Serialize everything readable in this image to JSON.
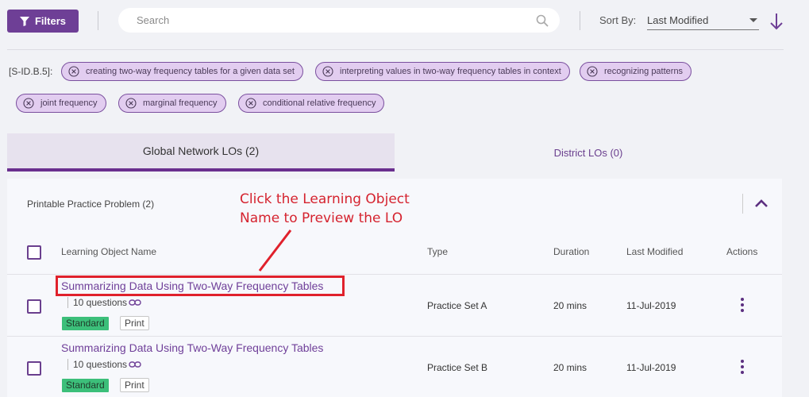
{
  "toolbar": {
    "filters_label": "Filters",
    "search_placeholder": "Search",
    "sort_label": "Sort By:",
    "sort_value": "Last Modified"
  },
  "standard": {
    "code": "[S-ID.B.5]:",
    "chips": [
      "creating two-way frequency tables for a given data set",
      "interpreting values in two-way frequency tables in context",
      "recognizing patterns",
      "joint frequency",
      "marginal frequency",
      "conditional relative frequency"
    ]
  },
  "tabs": {
    "global": "Global Network LOs (2)",
    "district": "District LOs (0)"
  },
  "section": {
    "title": "Printable Practice Problem (2)"
  },
  "table": {
    "headers": {
      "name": "Learning Object Name",
      "type": "Type",
      "duration": "Duration",
      "modified": "Last Modified",
      "actions": "Actions"
    },
    "rows": [
      {
        "name": "Summarizing Data Using Two-Way Frequency Tables",
        "questions": "10 questions",
        "badge": "Standard",
        "print": "Print",
        "type": "Practice Set A",
        "duration": "20 mins",
        "modified": "11-Jul-2019"
      },
      {
        "name": "Summarizing Data Using Two-Way Frequency Tables",
        "questions": "10 questions",
        "badge": "Standard",
        "print": "Print",
        "type": "Practice Set B",
        "duration": "20 mins",
        "modified": "11-Jul-2019"
      }
    ]
  },
  "annotation": {
    "line1": "Click the Learning Object",
    "line2": "Name to Preview the LO",
    "color": "#d5232f"
  },
  "colors": {
    "accent": "#6e3f96",
    "chip_bg": "#e2cdf0",
    "standard_badge": "#3cbf7a"
  }
}
